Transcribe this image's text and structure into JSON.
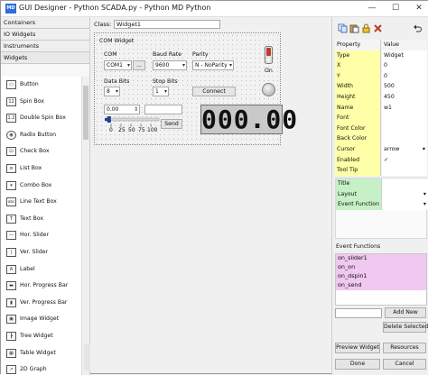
{
  "window": {
    "title": "GUI Designer - Python SCADA.py - Python MD Python",
    "app_icon_text": "MD"
  },
  "left_panel": {
    "categories": [
      "Containers",
      "IO Widgets",
      "Instruments",
      "Widgets"
    ],
    "widgets": [
      {
        "label": "Button",
        "icon": "button-icon",
        "glyph": "▭"
      },
      {
        "label": "Spin Box",
        "icon": "spinbox-icon",
        "glyph": "12"
      },
      {
        "label": "Double Spin Box",
        "icon": "double-spinbox-icon",
        "glyph": "1.2"
      },
      {
        "label": "Radio Button",
        "icon": "radio-button-icon",
        "glyph": "◉"
      },
      {
        "label": "Check Box",
        "icon": "checkbox-icon",
        "glyph": "☑"
      },
      {
        "label": "List Box",
        "icon": "listbox-icon",
        "glyph": "≡"
      },
      {
        "label": "Combo Box",
        "icon": "combobox-icon",
        "glyph": "▾"
      },
      {
        "label": "Line Text Box",
        "icon": "line-text-icon",
        "glyph": "abc"
      },
      {
        "label": "Text Box",
        "icon": "textbox-icon",
        "glyph": "T"
      },
      {
        "label": "Hor. Slider",
        "icon": "hslider-icon",
        "glyph": "—"
      },
      {
        "label": "Ver. Slider",
        "icon": "vslider-icon",
        "glyph": "|"
      },
      {
        "label": "Label",
        "icon": "label-icon",
        "glyph": "A"
      },
      {
        "label": "Hor. Progress Bar",
        "icon": "hprogress-icon",
        "glyph": "▬"
      },
      {
        "label": "Ver. Progress Bar",
        "icon": "vprogress-icon",
        "glyph": "▮"
      },
      {
        "label": "Image Widget",
        "icon": "image-icon",
        "glyph": "▣"
      },
      {
        "label": "Tree Widget",
        "icon": "tree-icon",
        "glyph": "┣"
      },
      {
        "label": "Table Widget",
        "icon": "table-icon",
        "glyph": "▦"
      },
      {
        "label": "2D Graph",
        "icon": "graph-icon",
        "glyph": "↗"
      }
    ]
  },
  "designer": {
    "class_label": "Class:",
    "class_value": "Widget1",
    "form": {
      "group_title": "COM Widget",
      "com_label": "COM",
      "com_value": "COM1",
      "com_button": "...",
      "baud_label": "Baud Rate",
      "baud_value": "9600",
      "parity_label": "Parity",
      "parity_value": "N - NoParity",
      "data_bits_label": "Data Bits",
      "data_bits_value": "8",
      "stop_bits_label": "Stop Bits",
      "stop_bits_value": "1",
      "connect_label": "Connect",
      "toggle_label": "On",
      "spin_value": "0.00",
      "send_label": "Send",
      "slider_ticks": [
        "0",
        "25",
        "50",
        "75",
        "100"
      ],
      "slider_fraction": 0.08,
      "lcd_value": "000.00"
    }
  },
  "right_panel": {
    "properties_header": {
      "name": "Property",
      "value": "Value"
    },
    "properties": [
      {
        "name": "Type",
        "value": "Widget"
      },
      {
        "name": "X",
        "value": "0"
      },
      {
        "name": "Y",
        "value": "0"
      },
      {
        "name": "Width",
        "value": "500"
      },
      {
        "name": "Height",
        "value": "450"
      },
      {
        "name": "Name",
        "value": "w1"
      },
      {
        "name": "Font",
        "value": ""
      },
      {
        "name": "Font Color",
        "value": ""
      },
      {
        "name": "Back Color",
        "value": ""
      },
      {
        "name": "Cursor",
        "value": "arrow"
      },
      {
        "name": "Enabled",
        "value": "✓"
      },
      {
        "name": "Tool Tip",
        "value": ""
      }
    ],
    "extra_properties": [
      {
        "name": "Title",
        "value": ""
      },
      {
        "name": "Layout",
        "value": ""
      },
      {
        "name": "Event Function",
        "value": ""
      }
    ],
    "events_label": "Event Functions",
    "events": [
      "on_slider1",
      "on_on",
      "on_dspin1",
      "on_send"
    ],
    "add_new_label": "Add New",
    "delete_selected_label": "Delete Selected",
    "preview_label": "Preview Widget",
    "resources_label": "Resources",
    "done_label": "Done",
    "cancel_label": "Cancel"
  },
  "colors": {
    "property_name_bg": "#ffffa8",
    "extra_property_bg": "#c6f0c6",
    "event_bg": "#f0c8f0",
    "toggle_red": "#c0392b",
    "slider_blue": "#1f3f8f"
  }
}
